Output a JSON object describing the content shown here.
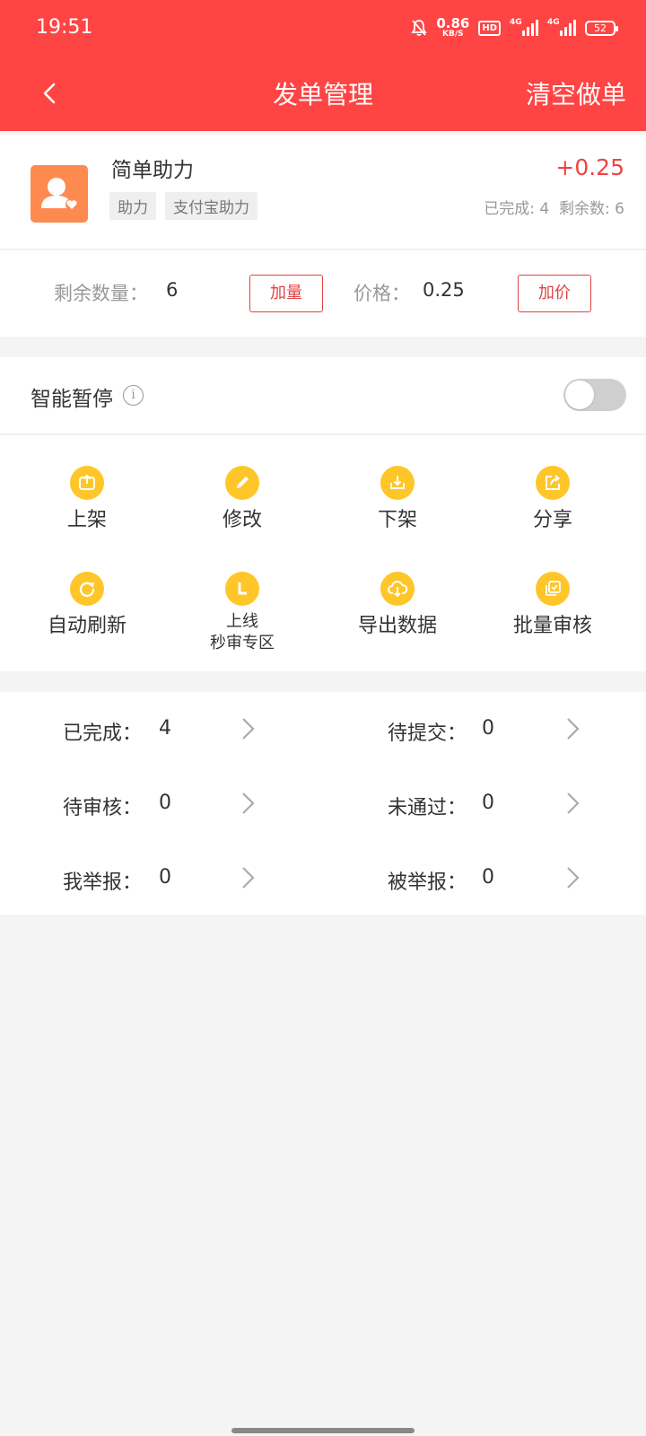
{
  "status_bar": {
    "time": "19:51",
    "speed_value": "0.86",
    "speed_unit": "KB/S",
    "hd_label": "HD",
    "sig1": "4G",
    "sig2": "4G",
    "battery": "52"
  },
  "navbar": {
    "title": "发单管理",
    "right_action": "清空做单"
  },
  "task": {
    "name": "简单助力",
    "tags": [
      "助力",
      "支付宝助力"
    ],
    "reward": "+0.25",
    "completed_label": "已完成:",
    "completed_value": "4",
    "remaining_label": "剩余数:",
    "remaining_value": "6"
  },
  "quantity": {
    "remaining_label": "剩余数量：",
    "remaining_value": "6",
    "add_qty_button": "加量",
    "price_label": "价格：",
    "price_value": "0.25",
    "add_price_button": "加价"
  },
  "smart_pause": {
    "label": "智能暂停",
    "info_glyph": "i",
    "enabled": false
  },
  "actions": [
    {
      "label": "上架",
      "icon": "upload-icon"
    },
    {
      "label": "修改",
      "icon": "pencil-icon"
    },
    {
      "label": "下架",
      "icon": "download-icon"
    },
    {
      "label": "分享",
      "icon": "share-icon"
    },
    {
      "label": "自动刷新",
      "icon": "refresh-icon"
    },
    {
      "label_line1": "上线",
      "label_line2": "秒审专区",
      "icon": "clock-icon"
    },
    {
      "label": "导出数据",
      "icon": "cloud-download-icon"
    },
    {
      "label": "批量审核",
      "icon": "batch-review-icon"
    }
  ],
  "counts": [
    {
      "label": "已完成：",
      "value": "4"
    },
    {
      "label": "待提交：",
      "value": "0"
    },
    {
      "label": "待审核：",
      "value": "0"
    },
    {
      "label": "未通过：",
      "value": "0"
    },
    {
      "label": "我举报：",
      "value": "0"
    },
    {
      "label": "被举报：",
      "value": "0"
    }
  ],
  "colors": {
    "primary": "#ff4444",
    "accent_red": "#f14343",
    "icon_yellow": "#ffc629",
    "avatar_orange": "#ff8a50"
  }
}
